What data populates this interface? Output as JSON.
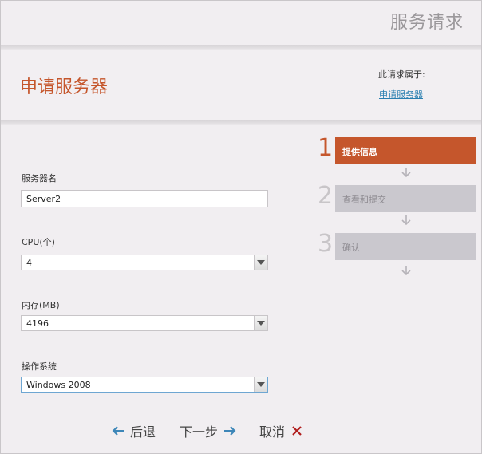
{
  "header": {
    "portal_title": "服务请求"
  },
  "title_band": {
    "page_title": "申请服务器",
    "belongs_label": "此请求属于:",
    "belongs_link": "申请服务器"
  },
  "form": {
    "server_name": {
      "label": "服务器名",
      "value": "Server2"
    },
    "cpu": {
      "label": "CPU(个)",
      "value": "4"
    },
    "memory": {
      "label": "内存(MB)",
      "value": "4196"
    },
    "os": {
      "label": "操作系统",
      "value": "Windows 2008"
    }
  },
  "steps": [
    {
      "number": "1",
      "label": "提供信息",
      "active": true
    },
    {
      "number": "2",
      "label": "查看和提交",
      "active": false
    },
    {
      "number": "3",
      "label": "确认",
      "active": false
    }
  ],
  "footer": {
    "back_label": "后退",
    "next_label": "下一步",
    "cancel_label": "取消"
  },
  "colors": {
    "accent": "#c5562c",
    "link": "#2a7fb0",
    "arrow_blue": "#3d86b8",
    "cancel_red": "#b01c1c",
    "step_inactive": "#cac8ce"
  },
  "icons": {
    "back": "arrow-left-icon",
    "next": "arrow-right-icon",
    "cancel": "close-icon",
    "step_connector": "arrow-down-icon",
    "dropdown": "chevron-down-icon"
  }
}
